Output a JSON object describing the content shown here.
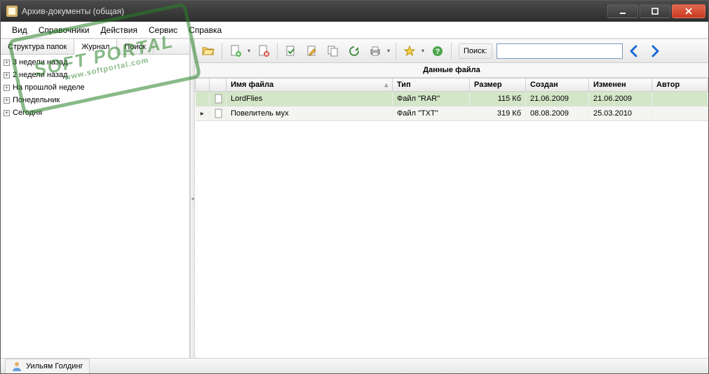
{
  "window": {
    "title": "Архив-документы (общая)"
  },
  "menu": {
    "items": [
      "Вид",
      "Справочники",
      "Действия",
      "Сервис",
      "Справка"
    ]
  },
  "sidebar": {
    "tabs": [
      "Структура папок",
      "Журнал",
      "Поиск"
    ],
    "active_tab": 1,
    "items": [
      "3 недели назад",
      "2 недели назад",
      "На прошлой неделе",
      "Понедельник",
      "Сегодня"
    ]
  },
  "toolbar": {
    "search_label": "Поиск:",
    "search_value": ""
  },
  "table": {
    "section_title": "Данные файла",
    "columns": [
      "Имя файла",
      "Тип",
      "Размер",
      "Создан",
      "Изменен",
      "Автор"
    ],
    "rows": [
      {
        "name": "LordFlies",
        "type": "Файл \"RAR\"",
        "size": "115 Кб",
        "created": "21.06.2009",
        "modified": "21.06.2009",
        "author": ""
      },
      {
        "name": "Повелитель мух",
        "type": "Файл \"TXT\"",
        "size": "319 Кб",
        "created": "08.08.2009",
        "modified": "25.03.2010",
        "author": ""
      }
    ]
  },
  "status": {
    "text": "Уильям Голдинг"
  },
  "watermark": {
    "line1": "SOFT PORTAL",
    "line2": "www.softportal.com"
  }
}
